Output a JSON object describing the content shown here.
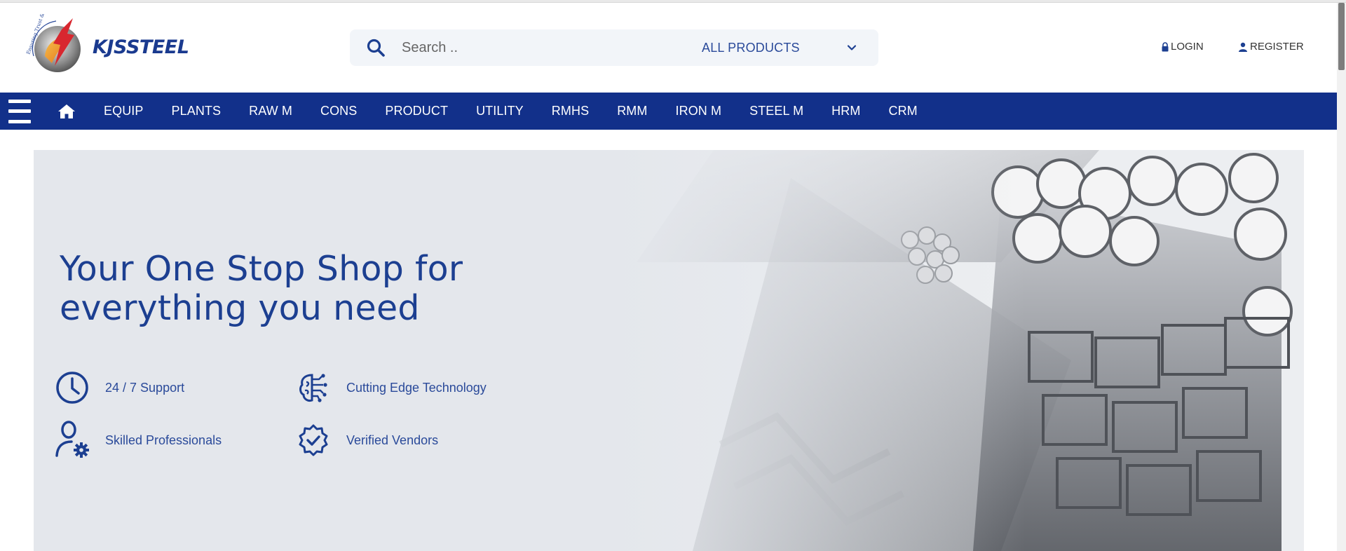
{
  "brand": {
    "name": "KJSSTEEL",
    "logo_arc_text": "Ensuring Trust & Excellence"
  },
  "colors": {
    "primary": "#12308a",
    "accent": "#1c3f91",
    "hero_bg": "#e4e7ec"
  },
  "search": {
    "placeholder": "Search ..",
    "category": "ALL PRODUCTS",
    "icon": "search-icon"
  },
  "auth": {
    "login": "LOGIN",
    "register": "REGISTER"
  },
  "nav": {
    "items": [
      "EQUIP",
      "PLANTS",
      "RAW M",
      "CONS",
      "PRODUCT",
      "UTILITY",
      "RMHS",
      "RMM",
      "IRON M",
      "STEEL M",
      "HRM",
      "CRM"
    ]
  },
  "hero": {
    "title_line1": "Your One Stop Shop for",
    "title_line2": "everything you need",
    "features": [
      {
        "label": "24 / 7 Support",
        "icon": "clock-icon"
      },
      {
        "label": "Cutting Edge Technology",
        "icon": "circuit-brain-icon"
      },
      {
        "label": "Skilled Professionals",
        "icon": "user-gear-icon"
      },
      {
        "label": "Verified Vendors",
        "icon": "verified-badge-icon"
      }
    ]
  }
}
